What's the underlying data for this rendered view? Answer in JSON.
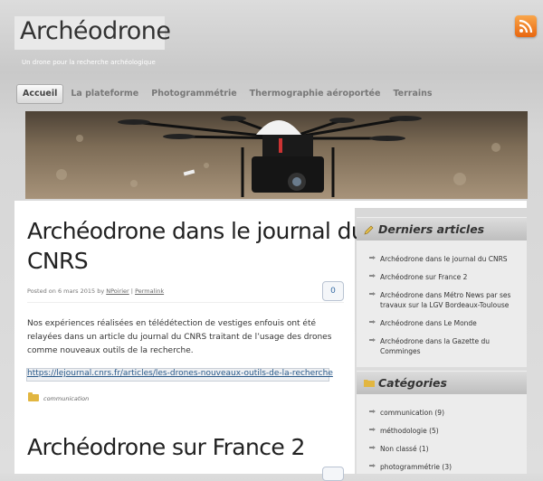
{
  "header": {
    "site_title": "Archéodrone",
    "tagline": "Un drone pour la recherche archéologique"
  },
  "nav": {
    "items": [
      "Accueil",
      "La plateforme",
      "Photogrammétrie",
      "Thermographie aéroportée",
      "Terrains"
    ],
    "active": "Accueil"
  },
  "posts": [
    {
      "title_line1": "Archéodrone dans le journal du",
      "title_line2": "CNRS",
      "meta_prefix": "Posted on 6 mars 2015 by ",
      "author": "NPoirier",
      "sep": " | ",
      "permalink": "Permalink",
      "comments": "0",
      "excerpt": "Nos expériences réalisées en télédétection de vestiges enfouis ont été relayées dans un article du journal du CNRS traitant de l’usage des drones comme nouveaux outils de la recherche.",
      "link": "https://lejournal.cnrs.fr/articles/les-drones-nouveaux-outils-de-la-recherche",
      "category": "communication"
    },
    {
      "title_line1": "Archéodrone sur France 2"
    }
  ],
  "sidebar": {
    "recent": {
      "title": "Derniers articles",
      "items": [
        "Archéodrone dans le journal du CNRS",
        "Archéodrone sur France 2",
        "Archéodrone dans Métro News par ses travaux sur la LGV Bordeaux-Toulouse",
        "Archéodrone dans Le Monde",
        "Archéodrone dans la Gazette du Comminges"
      ]
    },
    "categories": {
      "title": "Catégories",
      "items": [
        "communication (9)",
        "méthodologie (5)",
        "Non classé (1)",
        "photogrammétrie (3)"
      ]
    }
  },
  "colors": {
    "accent_link": "#2a5a8a",
    "rss_orange": "#f08a24",
    "folder_yellow": "#e2b640"
  },
  "icons": {
    "rss": "rss-icon",
    "folder": "folder-icon",
    "pencil": "pencil-icon",
    "arrow": "arrow-right-icon"
  }
}
